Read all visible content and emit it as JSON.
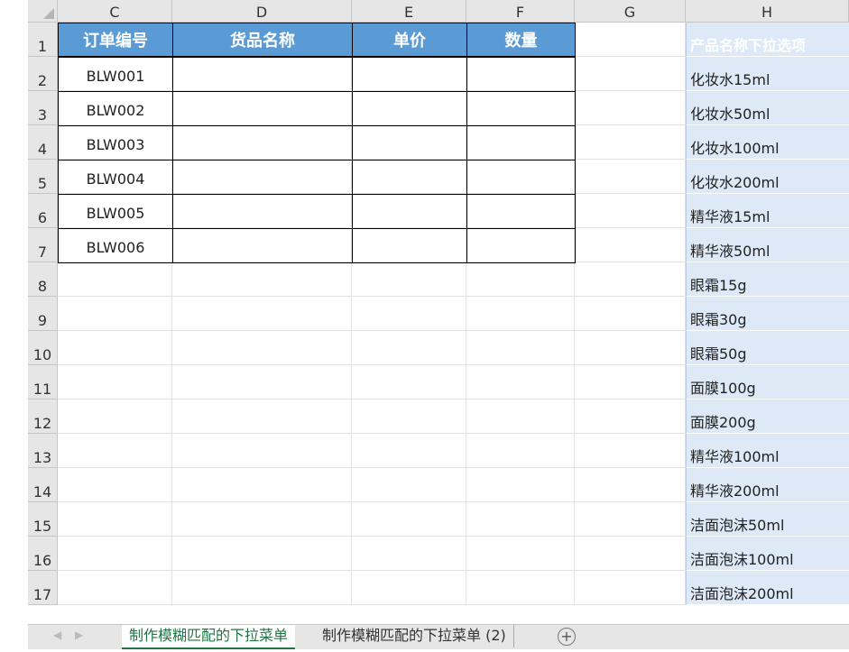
{
  "columns": [
    "C",
    "D",
    "E",
    "F",
    "G",
    "H"
  ],
  "rows": [
    "1",
    "2",
    "3",
    "4",
    "5",
    "6",
    "7",
    "8",
    "9",
    "10",
    "11",
    "12",
    "13",
    "14",
    "15",
    "16",
    "17"
  ],
  "table": {
    "headers": [
      "订单编号",
      "货品名称",
      "单价",
      "数量"
    ],
    "order_ids": [
      "BLW001",
      "BLW002",
      "BLW003",
      "BLW004",
      "BLW005",
      "BLW006"
    ]
  },
  "options": {
    "header": "产品名称下拉选项",
    "items": [
      "化妆水15ml",
      "化妆水50ml",
      "化妆水100ml",
      "化妆水200ml",
      "精华液15ml",
      "精华液50ml",
      "眼霜15g",
      "眼霜30g",
      "眼霜50g",
      "面膜100g",
      "面膜200g",
      "精华液100ml",
      "精华液200ml",
      "洁面泡沫50ml",
      "洁面泡沫100ml",
      "洁面泡沫200ml"
    ]
  },
  "sheets": {
    "tabs": [
      "制作模糊匹配的下拉菜单",
      "制作模糊匹配的下拉菜单 (2)"
    ],
    "add": "+"
  },
  "colors": {
    "header_blue": "#5b9bd5",
    "option_fill": "#dde9f7",
    "active_tab": "#217346"
  }
}
